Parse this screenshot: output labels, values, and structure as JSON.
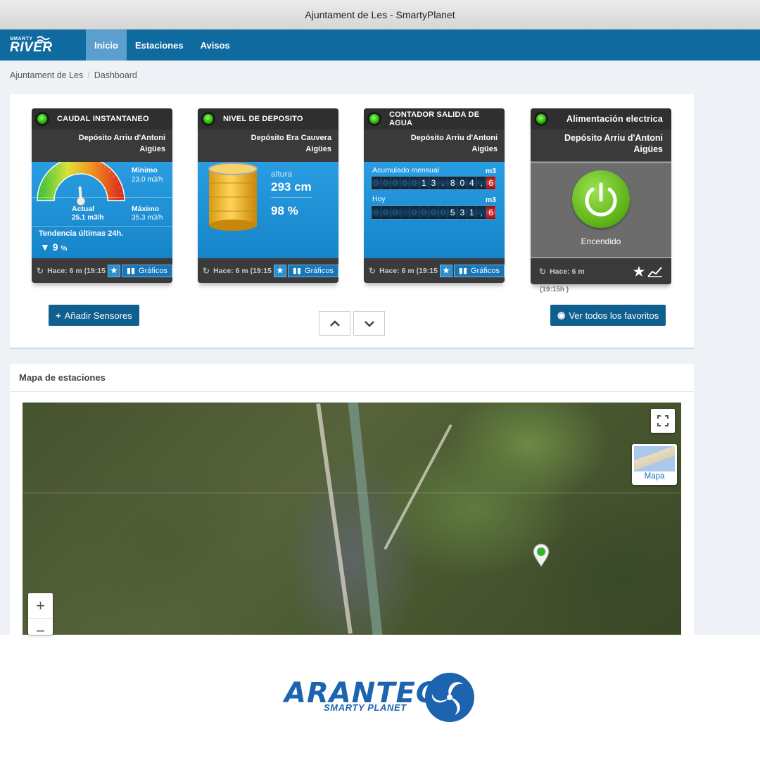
{
  "window": {
    "title": "Ajuntament de Les - SmartyPlanet"
  },
  "brand": {
    "small": "SMARTY",
    "big": "RIVER"
  },
  "nav": {
    "items": [
      "Inicio",
      "Estaciones",
      "Avisos"
    ]
  },
  "breadcrumb": {
    "items": [
      "Ajuntament de Les",
      "Dashboard"
    ]
  },
  "cards": {
    "caudal": {
      "title": "CAUDAL INSTANTANEO",
      "site": "Depósito Arriu d'Antoni",
      "sub": "Aigües",
      "min_label": "Mínimo",
      "min_value": "23.0",
      "min_unit": "m3/h",
      "max_label": "Máximo",
      "max_value": "35.3",
      "max_unit": "m3/h",
      "actual_label": "Actual",
      "actual_value": "25.1",
      "actual_unit": "m3/h",
      "trend_label": "Tendencia últimas 24h.",
      "trend_value": "9",
      "trend_unit": "%",
      "gauge_fraction": 0.18
    },
    "nivel": {
      "title": "NIVEL DE DEPOSITO",
      "site": "Depósito Era Cauvera",
      "sub": "Aigües",
      "height_label": "altura",
      "height_value": "293 cm",
      "percent": "98 %"
    },
    "contador": {
      "title": "CONTADOR SALIDA DE AGUA",
      "site": "Depósito Arriu d'Antoni",
      "sub": "Aigües",
      "monthly_label": "Acumulado mensual",
      "monthly_unit": "m3",
      "monthly_digits": [
        "0",
        "0",
        "0",
        "0",
        "0",
        "1",
        "3",
        ".",
        "8",
        "0",
        "4",
        ",",
        "6"
      ],
      "today_label": "Hoy",
      "today_unit": "m3",
      "today_digits": [
        "0",
        "0",
        "0",
        ".",
        "0",
        "0",
        "0",
        "0",
        "5",
        "3",
        "1",
        ",",
        "6"
      ]
    },
    "alimentacion": {
      "title": "Alimentación electrica",
      "site": "Depósito Arriu d'Antoni",
      "sub": "Aigües",
      "state": "Encendido",
      "updated": "Hace: 6 m",
      "updated_extra": "(19:15h )"
    },
    "footer": {
      "updated": "Hace: 6 m (19:15",
      "graphs_label": "Gráficos"
    }
  },
  "actions": {
    "add_sensors": "Añadir Sensores",
    "view_favorites": "Ver todos los favoritos"
  },
  "map": {
    "title": "Mapa de estaciones",
    "layer_label": "Mapa",
    "zoom_in": "+",
    "zoom_out": "−"
  },
  "logo": {
    "word": "ARANTEC",
    "tag": "SMARTY PLANET"
  },
  "colors": {
    "navbar": "#0f6aa0",
    "card_body": "#1c8fd6",
    "led_on": "#25b000",
    "power_on": "#5fb41a",
    "logo": "#1d64b0"
  }
}
